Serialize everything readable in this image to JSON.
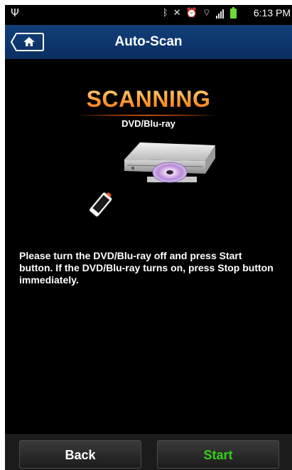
{
  "status_bar": {
    "usb_icon": "usb-icon",
    "bluetooth_icon": "bluetooth-icon",
    "mute_icon": "mute-icon",
    "alarm_icon": "alarm-icon",
    "wifi_icon": "wifi-icon",
    "signal_icon": "signal-icon",
    "battery_icon": "battery-charging-icon",
    "time": "6:13 PM"
  },
  "header": {
    "home_icon": "home-icon",
    "title": "Auto-Scan"
  },
  "main": {
    "status_heading": "SCANNING",
    "device_type": "DVD/Blu-ray",
    "instructions": "Please turn the DVD/Blu-ray off and press Start button. If the DVD/Blu-ray turns on, press Stop button immediately."
  },
  "footer": {
    "back_label": "Back",
    "start_label": "Start"
  },
  "colors": {
    "header_bg": "#0d3369",
    "scanning_orange": "#ff9b2f",
    "start_green": "#36d016",
    "battery_green": "#6fd83b"
  }
}
